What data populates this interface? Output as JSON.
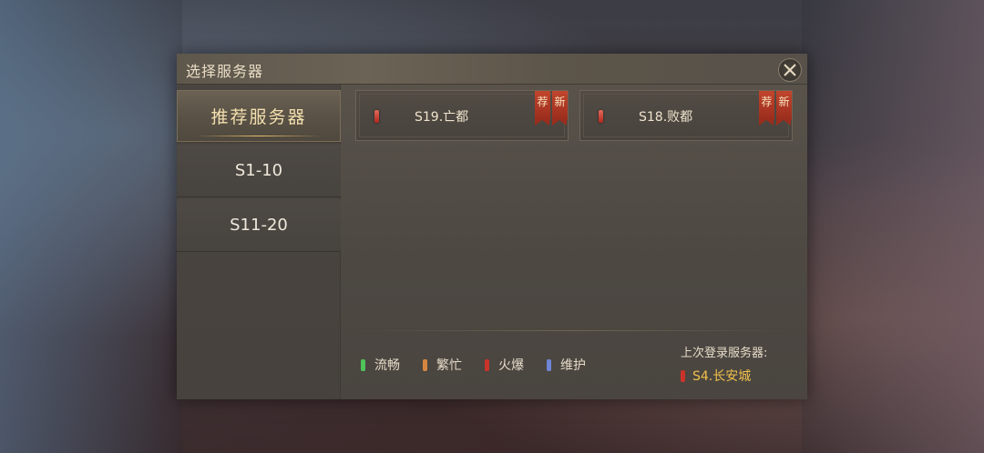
{
  "dialog": {
    "title": "选择服务器"
  },
  "sidebar": {
    "items": [
      {
        "label": "推荐服务器",
        "active": true
      },
      {
        "label": "S1-10",
        "active": false
      },
      {
        "label": "S11-20",
        "active": false
      }
    ]
  },
  "servers": [
    {
      "name": "S19.亡都",
      "status": "hot",
      "tags": [
        "荐",
        "新"
      ]
    },
    {
      "name": "S18.败都",
      "status": "hot",
      "tags": [
        "荐",
        "新"
      ]
    }
  ],
  "legend": [
    {
      "label": "流畅",
      "color": "#4fc45a"
    },
    {
      "label": "繁忙",
      "color": "#d6873f"
    },
    {
      "label": "火爆",
      "color": "#c9332a"
    },
    {
      "label": "维护",
      "color": "#6f86d6"
    }
  ],
  "last_login": {
    "label": "上次登录服务器:",
    "server": "S4.长安城",
    "status_color": "#c9332a"
  },
  "colors": {
    "accent_gold": "#f3dfae",
    "hot_red": "#c9332a"
  }
}
